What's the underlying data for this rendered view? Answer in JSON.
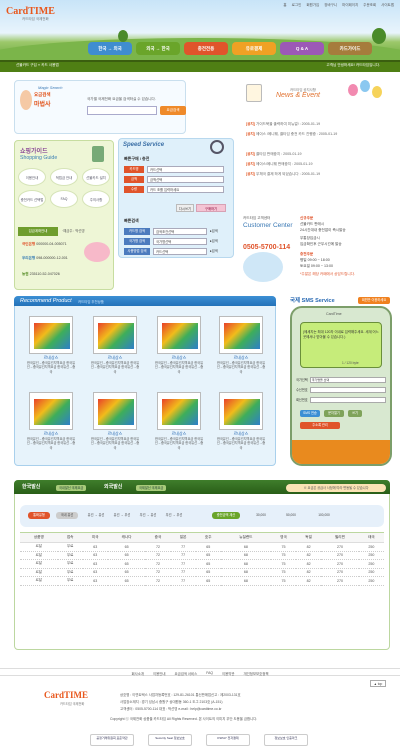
{
  "header": {
    "logo": "CardTIME",
    "logo_sub": "카드타임 국제전화",
    "top_links": [
      "홈",
      "로그인",
      "회원가입",
      "장바구니",
      "마이페이지",
      "주문조회",
      "사이트맵"
    ],
    "nav": [
      {
        "label": "한국 → 외국",
        "color": "#3f8dd0"
      },
      {
        "label": "외국 → 한국",
        "color": "#6aa52a"
      },
      {
        "label": "충전전용",
        "color": "#e0542b"
      },
      {
        "label": "유로결제",
        "color": "#f0a124"
      },
      {
        "label": "Q & A",
        "color": "#9c59b6"
      },
      {
        "label": "카드가이드",
        "color": "#a67c3c"
      }
    ],
    "subbar_left": "선불카드 구입 ›› 카드 사용법",
    "subbar_right": "고객님 안녕하세요! 카드타임입니다."
  },
  "magic": {
    "title": "Magic Search",
    "sub1": "요금검색",
    "sub2": "마법사",
    "text": "국가별 국제전화 요금을 검색하실 수 있습니다.",
    "button": "요금검색"
  },
  "guide": {
    "title_ko": "쇼핑가이드",
    "title_en": "Shopping Guide",
    "items": [
      "이용안내",
      "적립금 안내",
      "선불카드 설치",
      "충전카드 선택법",
      "FAQ",
      "주의사항"
    ],
    "subtitle": "입금계좌안내",
    "subtitle_right": "·예금주 : 박선영",
    "accounts": [
      {
        "bank": "국민은행",
        "no": "000000-04-005071"
      },
      {
        "bank": "우리은행",
        "no": "098-000000-12-001"
      },
      {
        "bank": "농협",
        "no": "235110-52-047026"
      }
    ]
  },
  "speed": {
    "title": "Speed Service",
    "section1": "빠른구매 / 충전",
    "rows": [
      {
        "tag": "카드명",
        "value": "카드선택"
      },
      {
        "tag": "금액",
        "value": "금액선택"
      },
      {
        "tag": "수량",
        "value": "카드 조를 입력하세요"
      }
    ],
    "reset": "다시쓰기",
    "search": "구매하기",
    "section2": "빠른검색",
    "search_rows": [
      {
        "tag": "카드명 검색",
        "value": "검색조건선택"
      },
      {
        "tag": "국가명 검색",
        "value": "국가명선택"
      },
      {
        "tag": "사용방법 검색",
        "value": "카드선택"
      }
    ],
    "go": "▸검색"
  },
  "news": {
    "sub": "카드타임 공지사항",
    "title": "News & Event",
    "items": [
      {
        "tag": "[공지]",
        "text": "가이드북을 출력하여 미뉴얼! : 2005-01-19"
      },
      {
        "tag": "[공지]",
        "text": "에이스 /에니웨, 쿨타임 충전 카드 진행중 : 2005-01-19"
      },
      {
        "tag": "[공지]",
        "text": "쿨타임 판매중지 : 2005-01-19"
      },
      {
        "tag": "[공지]",
        "text": "에이스/에니웨 판매중지 : 2005-01-19"
      },
      {
        "tag": "[공지]",
        "text": "우체국 결제 하게 되었습니다 : 2005-01-19"
      }
    ]
  },
  "customer": {
    "sub": "카드타임 고객센터",
    "title": "Customer Center",
    "phone": "0505-5700-114",
    "lines": [
      {
        "b": "신규주문",
        "t": ""
      },
      {
        "b": "",
        "t": "선불카드 판매시"
      },
      {
        "b": "",
        "t": "24시간대내 충전없이 즉시발송"
      },
      {
        "b": "",
        "t": "무통장입금시"
      },
      {
        "b": "",
        "t": "입금확인후 근무시간에 발송"
      },
      {
        "b": "충전주문",
        "t": ""
      },
      {
        "b": "",
        "t": "평일 09:00 ~ 18:00"
      },
      {
        "b": "",
        "t": "토요일 09:00 ~ 13:00"
      },
      {
        "b": "",
        "t": "*주말은 해당 카페에서 상담드립니다."
      }
    ]
  },
  "recommend": {
    "title": "Recommend Product",
    "sub": "카드타임 추천상품",
    "cards": [
      {
        "name": "르네상스",
        "desc": "한국유선→중국유선지역요금 한국유선→중국유선지역요금 한국유선→중국"
      },
      {
        "name": "르네상스",
        "desc": "한국유선→중국유선지역요금 한국유선→중국유선지역요금 한국유선→중국"
      },
      {
        "name": "르네상스",
        "desc": "한국유선→중국유선지역요금 한국유선→중국유선지역요금 한국유선→중국"
      },
      {
        "name": "르네상스",
        "desc": "한국유선→중국유선지역요금 한국유선→중국유선지역요금 한국유선→중국"
      },
      {
        "name": "르네상스",
        "desc": "한국유선→중국유선지역요금 한국유선→중국유선지역요금 한국유선→중국"
      },
      {
        "name": "르네상스",
        "desc": "한국유선→중국유선지역요금 한국유선→중국유선지역요금 한국유선→중국"
      },
      {
        "name": "르네상스",
        "desc": "한국유선→중국유선지역요금 한국유선→중국유선지역요금 한국유선→중국"
      },
      {
        "name": "르네상스",
        "desc": "한국유선→중국유선지역요금 한국유선→중국유선지역요금 한국유선→중국"
      }
    ]
  },
  "sms": {
    "title": "국제 SMS Service",
    "badge": "회원만 이용하세요",
    "brand": "CardTime",
    "screen": "(메세지는 최대 120자 이내로 입력해주세요. 세계 어느 곳에서나 받아볼 수 있습니다.)",
    "count": "1 / 120 byte",
    "rows": [
      {
        "label": "국가선택",
        "value": "국가명을 선택"
      },
      {
        "label": "수신번호",
        "value": ""
      },
      {
        "label": "회신번호",
        "value": ""
      }
    ],
    "buttons": [
      "SMS 전송",
      "문자열기",
      "쓰기",
      "주소록 관리"
    ]
  },
  "rates": {
    "tab1": "한국발신",
    "tab1_sub": "국내발신 국제요금",
    "tab2": "외국발신",
    "tab2_sub": "국제발신 국제요금",
    "notice": "※ 요금은 공급사 사정에 따라 변동될 수 있습니다",
    "filters": [
      "통화유형",
      "국내 유선",
      "유선 → 유선",
      "유선 → 무선",
      "무선 → 유선",
      "무선 → 무선"
    ],
    "amount_label": "충전금액 계산",
    "amounts": [
      "30,000",
      "50,000",
      "100,000"
    ],
    "columns": [
      "상품명",
      "접속",
      "미국",
      "캐나다",
      "중국",
      "일본",
      "호주",
      "뉴질랜드",
      "영국",
      "독일",
      "필리핀",
      "태국"
    ],
    "rows": [
      [
        "르달",
        "무료",
        "63",
        "65",
        "72",
        "77",
        "65",
        "68",
        "75",
        "82",
        "270",
        "250"
      ],
      [
        "르달",
        "무료",
        "63",
        "65",
        "72",
        "77",
        "65",
        "68",
        "75",
        "82",
        "270",
        "250"
      ],
      [
        "르달",
        "무료",
        "63",
        "65",
        "72",
        "77",
        "65",
        "68",
        "75",
        "82",
        "270",
        "250"
      ],
      [
        "르달",
        "무료",
        "63",
        "65",
        "72",
        "77",
        "65",
        "68",
        "75",
        "82",
        "270",
        "250"
      ],
      [
        "르달",
        "무료",
        "63",
        "65",
        "72",
        "77",
        "65",
        "68",
        "75",
        "82",
        "270",
        "250"
      ]
    ]
  },
  "footer": {
    "links": [
      "회사소개",
      "이용안내",
      "요금검색 서비스",
      "FAQ",
      "이용약관",
      "개인정보보호정책"
    ],
    "top": "▲ top",
    "logo": "CardTIME",
    "logo_sub": "카드타임 국제전화",
    "info": [
      "상호명 : 이연트텍스 사업자등록번호 : 129-81-26101 통신판매업신고 : 제2003-131호",
      "사업장소재지 : 경기 성남시 중원구 상대원동 360-1 도그 2103호 (A-151)",
      "고객센터 : 0505-5700-114 대표 : 박선영  e-mail : help@cardtime.co.kr",
      "Copyright ⓒ 국제전화 상품을 카드타임 All Rights Reserved.  본 사이트의 이미지 무단 도용을 금합니다."
    ],
    "marks": [
      "공정거래위원회 표준약관",
      "Security Seal 정보보호",
      "KSPAY 전자결제",
      "정보보호 인증마크"
    ]
  }
}
